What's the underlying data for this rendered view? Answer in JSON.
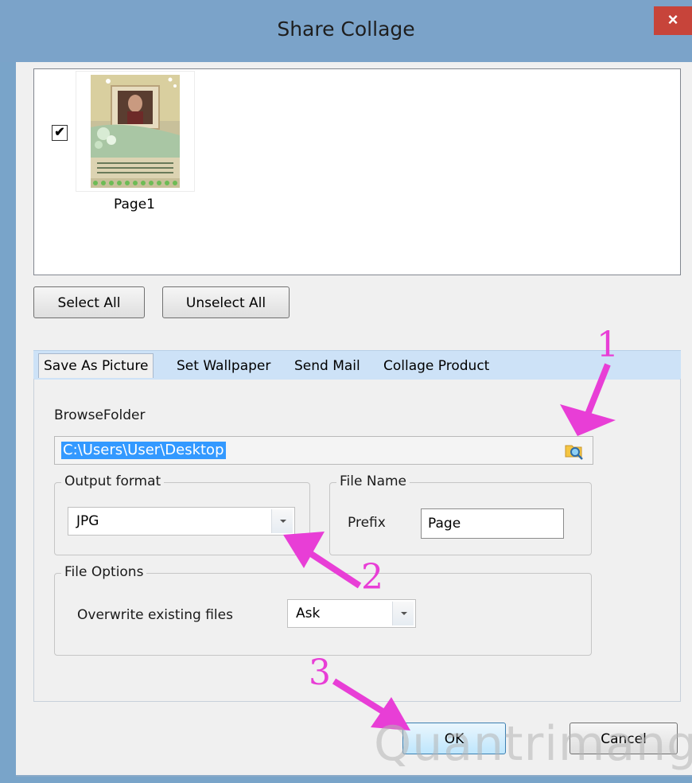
{
  "window": {
    "title": "Share Collage",
    "close_glyph": "×"
  },
  "pages": [
    {
      "label": "Page1",
      "checked": true,
      "check_glyph": "✔"
    }
  ],
  "buttons": {
    "select_all": "Select All",
    "unselect_all": "Unselect All",
    "ok": "OK",
    "cancel": "Cancel"
  },
  "tabs": [
    {
      "label": "Save As Picture",
      "active": true
    },
    {
      "label": "Set Wallpaper",
      "active": false
    },
    {
      "label": "Send Mail",
      "active": false
    },
    {
      "label": "Collage Product",
      "active": false
    }
  ],
  "save_as_picture": {
    "browse_label": "BrowseFolder",
    "folder_path": "C:\\Users\\User\\Desktop",
    "output_format": {
      "group_label": "Output format",
      "value": "JPG"
    },
    "file_name": {
      "group_label": "File Name",
      "prefix_label": "Prefix",
      "prefix_value": "Page"
    },
    "file_options": {
      "group_label": "File Options",
      "overwrite_label": "Overwrite existing files",
      "overwrite_value": "Ask"
    }
  },
  "annotations": {
    "marker_1": "1",
    "marker_2": "2",
    "marker_3": "3",
    "arrow_color": "#e83ed6"
  },
  "watermark": "Quantrimang"
}
